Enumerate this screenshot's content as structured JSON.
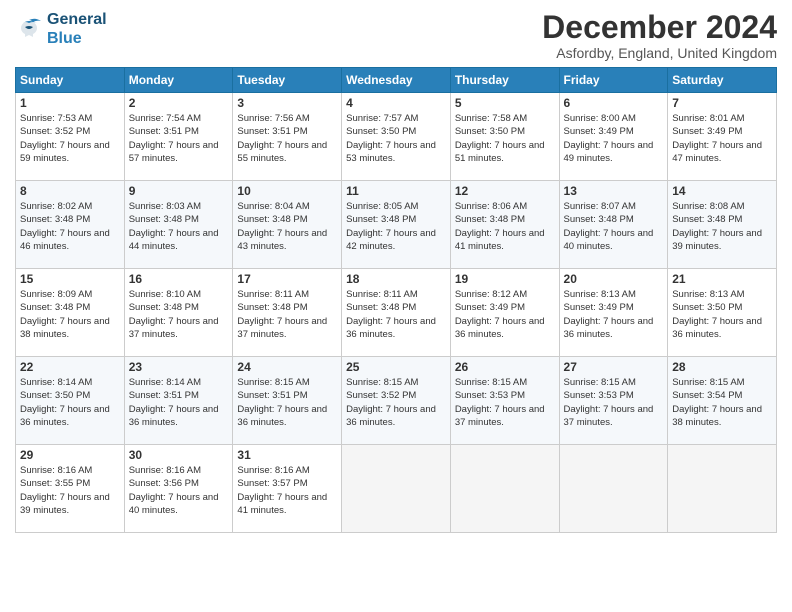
{
  "header": {
    "logo_line1": "General",
    "logo_line2": "Blue",
    "title": "December 2024",
    "location": "Asfordby, England, United Kingdom"
  },
  "weekdays": [
    "Sunday",
    "Monday",
    "Tuesday",
    "Wednesday",
    "Thursday",
    "Friday",
    "Saturday"
  ],
  "weeks": [
    [
      {
        "day": 1,
        "sunrise": "7:53 AM",
        "sunset": "3:52 PM",
        "daylight": "7 hours and 59 minutes."
      },
      {
        "day": 2,
        "sunrise": "7:54 AM",
        "sunset": "3:51 PM",
        "daylight": "7 hours and 57 minutes."
      },
      {
        "day": 3,
        "sunrise": "7:56 AM",
        "sunset": "3:51 PM",
        "daylight": "7 hours and 55 minutes."
      },
      {
        "day": 4,
        "sunrise": "7:57 AM",
        "sunset": "3:50 PM",
        "daylight": "7 hours and 53 minutes."
      },
      {
        "day": 5,
        "sunrise": "7:58 AM",
        "sunset": "3:50 PM",
        "daylight": "7 hours and 51 minutes."
      },
      {
        "day": 6,
        "sunrise": "8:00 AM",
        "sunset": "3:49 PM",
        "daylight": "7 hours and 49 minutes."
      },
      {
        "day": 7,
        "sunrise": "8:01 AM",
        "sunset": "3:49 PM",
        "daylight": "7 hours and 47 minutes."
      }
    ],
    [
      {
        "day": 8,
        "sunrise": "8:02 AM",
        "sunset": "3:48 PM",
        "daylight": "7 hours and 46 minutes."
      },
      {
        "day": 9,
        "sunrise": "8:03 AM",
        "sunset": "3:48 PM",
        "daylight": "7 hours and 44 minutes."
      },
      {
        "day": 10,
        "sunrise": "8:04 AM",
        "sunset": "3:48 PM",
        "daylight": "7 hours and 43 minutes."
      },
      {
        "day": 11,
        "sunrise": "8:05 AM",
        "sunset": "3:48 PM",
        "daylight": "7 hours and 42 minutes."
      },
      {
        "day": 12,
        "sunrise": "8:06 AM",
        "sunset": "3:48 PM",
        "daylight": "7 hours and 41 minutes."
      },
      {
        "day": 13,
        "sunrise": "8:07 AM",
        "sunset": "3:48 PM",
        "daylight": "7 hours and 40 minutes."
      },
      {
        "day": 14,
        "sunrise": "8:08 AM",
        "sunset": "3:48 PM",
        "daylight": "7 hours and 39 minutes."
      }
    ],
    [
      {
        "day": 15,
        "sunrise": "8:09 AM",
        "sunset": "3:48 PM",
        "daylight": "7 hours and 38 minutes."
      },
      {
        "day": 16,
        "sunrise": "8:10 AM",
        "sunset": "3:48 PM",
        "daylight": "7 hours and 37 minutes."
      },
      {
        "day": 17,
        "sunrise": "8:11 AM",
        "sunset": "3:48 PM",
        "daylight": "7 hours and 37 minutes."
      },
      {
        "day": 18,
        "sunrise": "8:11 AM",
        "sunset": "3:48 PM",
        "daylight": "7 hours and 36 minutes."
      },
      {
        "day": 19,
        "sunrise": "8:12 AM",
        "sunset": "3:49 PM",
        "daylight": "7 hours and 36 minutes."
      },
      {
        "day": 20,
        "sunrise": "8:13 AM",
        "sunset": "3:49 PM",
        "daylight": "7 hours and 36 minutes."
      },
      {
        "day": 21,
        "sunrise": "8:13 AM",
        "sunset": "3:50 PM",
        "daylight": "7 hours and 36 minutes."
      }
    ],
    [
      {
        "day": 22,
        "sunrise": "8:14 AM",
        "sunset": "3:50 PM",
        "daylight": "7 hours and 36 minutes."
      },
      {
        "day": 23,
        "sunrise": "8:14 AM",
        "sunset": "3:51 PM",
        "daylight": "7 hours and 36 minutes."
      },
      {
        "day": 24,
        "sunrise": "8:15 AM",
        "sunset": "3:51 PM",
        "daylight": "7 hours and 36 minutes."
      },
      {
        "day": 25,
        "sunrise": "8:15 AM",
        "sunset": "3:52 PM",
        "daylight": "7 hours and 36 minutes."
      },
      {
        "day": 26,
        "sunrise": "8:15 AM",
        "sunset": "3:53 PM",
        "daylight": "7 hours and 37 minutes."
      },
      {
        "day": 27,
        "sunrise": "8:15 AM",
        "sunset": "3:53 PM",
        "daylight": "7 hours and 37 minutes."
      },
      {
        "day": 28,
        "sunrise": "8:15 AM",
        "sunset": "3:54 PM",
        "daylight": "7 hours and 38 minutes."
      }
    ],
    [
      {
        "day": 29,
        "sunrise": "8:16 AM",
        "sunset": "3:55 PM",
        "daylight": "7 hours and 39 minutes."
      },
      {
        "day": 30,
        "sunrise": "8:16 AM",
        "sunset": "3:56 PM",
        "daylight": "7 hours and 40 minutes."
      },
      {
        "day": 31,
        "sunrise": "8:16 AM",
        "sunset": "3:57 PM",
        "daylight": "7 hours and 41 minutes."
      },
      null,
      null,
      null,
      null
    ]
  ]
}
